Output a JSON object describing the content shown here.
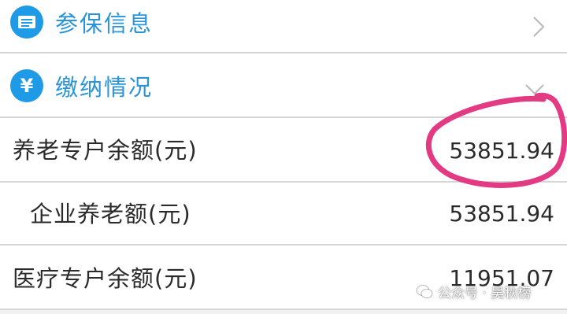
{
  "sections": [
    {
      "title": "参保信息",
      "icon": "id-card-icon"
    },
    {
      "title": "缴纳情况",
      "icon": "yen-icon",
      "icon_glyph": "¥"
    }
  ],
  "items": [
    {
      "label": "养老专户余额(元)",
      "value": "53851.94"
    },
    {
      "label": "企业养老额(元)",
      "value": "53851.94"
    },
    {
      "label": "医疗专户余额(元)",
      "value": "11951.07"
    }
  ],
  "watermark": {
    "text": "公众号 · 吴秋榜",
    "icon": "wechat-icon"
  },
  "colors": {
    "accent": "#2b94d8",
    "icon_bg": "#1e9ae6",
    "highlight": "#e23a83",
    "divider": "#d6d6d6"
  }
}
